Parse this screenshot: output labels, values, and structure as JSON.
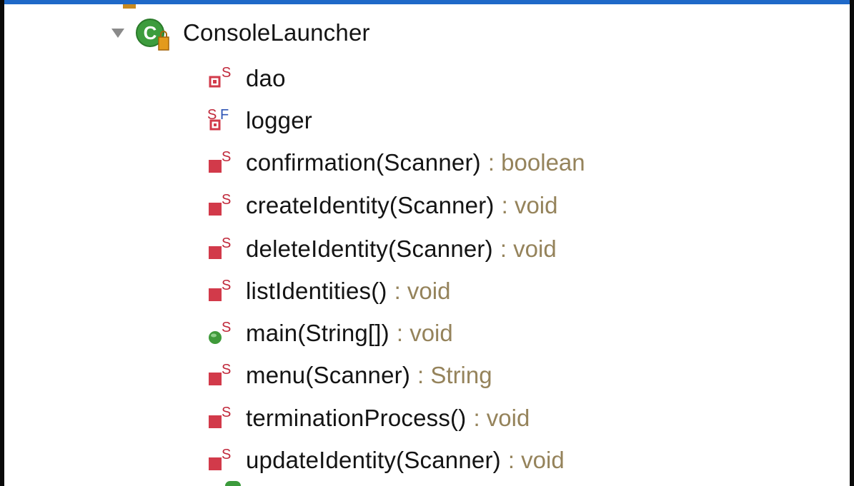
{
  "tree": {
    "class_node": {
      "label": "ConsoleLauncher",
      "icon": "class-icon",
      "expanded": true
    },
    "members": [
      {
        "id": "dao",
        "label": "dao",
        "return_type": "",
        "icon": "private-static-field-icon"
      },
      {
        "id": "logger",
        "label": "logger",
        "return_type": "",
        "icon": "private-static-final-field-icon"
      },
      {
        "id": "confirmation",
        "label": "confirmation(Scanner)",
        "return_type": ": boolean",
        "icon": "private-static-method-icon"
      },
      {
        "id": "createIdentity",
        "label": "createIdentity(Scanner)",
        "return_type": ": void",
        "icon": "private-static-method-icon"
      },
      {
        "id": "deleteIdentity",
        "label": "deleteIdentity(Scanner)",
        "return_type": ": void",
        "icon": "private-static-method-icon"
      },
      {
        "id": "listIdentities",
        "label": "listIdentities()",
        "return_type": ": void",
        "icon": "private-static-method-icon"
      },
      {
        "id": "main",
        "label": "main(String[])",
        "return_type": ": void",
        "icon": "public-static-method-icon"
      },
      {
        "id": "menu",
        "label": "menu(Scanner)",
        "return_type": ": String",
        "icon": "private-static-method-icon"
      },
      {
        "id": "terminationProcess",
        "label": "terminationProcess()",
        "return_type": ": void",
        "icon": "private-static-method-icon"
      },
      {
        "id": "updateIdentity",
        "label": "updateIdentity(Scanner)",
        "return_type": ": void",
        "icon": "private-static-method-icon"
      }
    ]
  },
  "colors": {
    "private_member": "#d23a4a",
    "public_member": "#3f9a3a",
    "static_marker": "#c0283a",
    "final_marker": "#2f55b5",
    "return_type": "#95835b",
    "label": "#141414"
  }
}
